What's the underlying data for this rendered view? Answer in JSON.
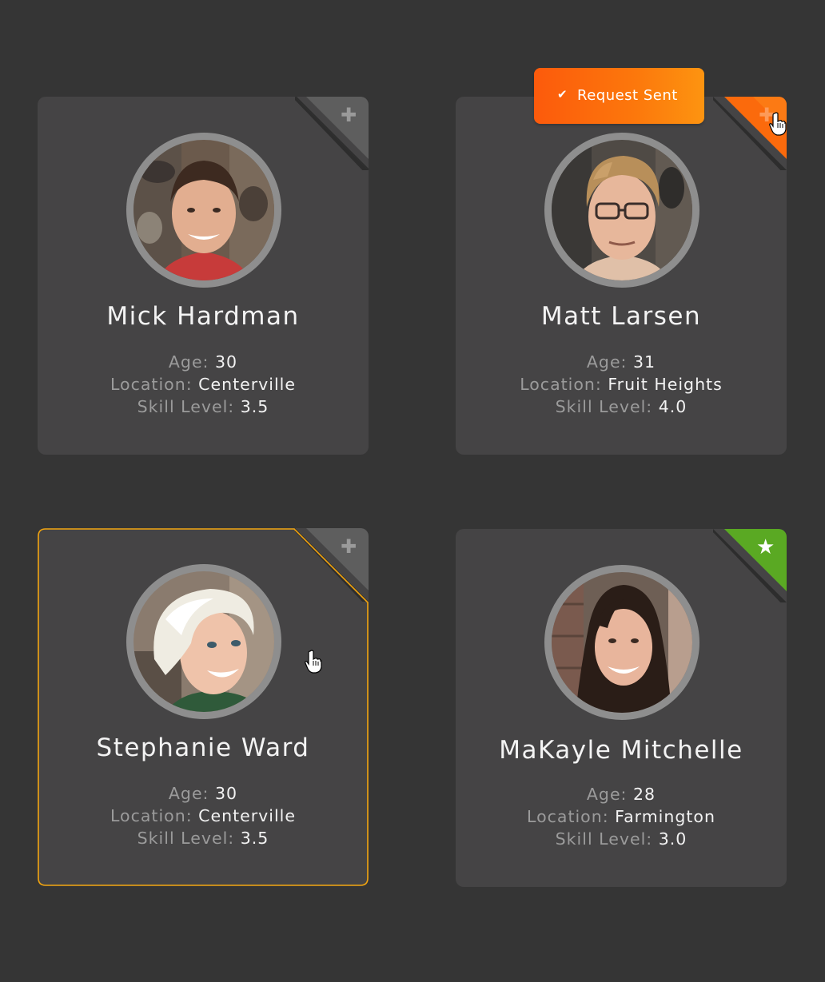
{
  "players": [
    {
      "name": "Mick Hardman",
      "age_label": "Age:",
      "age": "30",
      "location_label": "Location:",
      "location": "Centerville",
      "skill_label": "Skill Level:",
      "skill": "3.5",
      "action_icon": "plus-icon",
      "state": "default"
    },
    {
      "name": "Matt Larsen",
      "age_label": "Age:",
      "age": "31",
      "location_label": "Location:",
      "location": "Fruit Heights",
      "skill_label": "Skill Level:",
      "skill": "4.0",
      "action_icon": "plus-icon",
      "state": "request-sent"
    },
    {
      "name": "Stephanie Ward",
      "age_label": "Age:",
      "age": "30",
      "location_label": "Location:",
      "location": "Centerville",
      "skill_label": "Skill Level:",
      "skill": "3.5",
      "action_icon": "plus-icon",
      "state": "hover"
    },
    {
      "name": "MaKayle Mitchelle",
      "age_label": "Age:",
      "age": "28",
      "location_label": "Location:",
      "location": "Farmington",
      "skill_label": "Skill Level:",
      "skill": "3.0",
      "action_icon": "star-icon",
      "state": "favorite"
    }
  ],
  "toast": {
    "icon": "check-icon",
    "text": "Request Sent"
  },
  "colors": {
    "background": "#353535",
    "card": "#454445",
    "corner_default": "#5e5e5e",
    "corner_request_sent": "#fb6a0c",
    "corner_favorite": "#5aa923",
    "hover_outline": "#f0a30f",
    "toast_gradient_start": "#fc5a0c",
    "toast_gradient_end": "#fd9410",
    "label_text": "#9b9b9b",
    "value_text": "#f2f2f2"
  }
}
